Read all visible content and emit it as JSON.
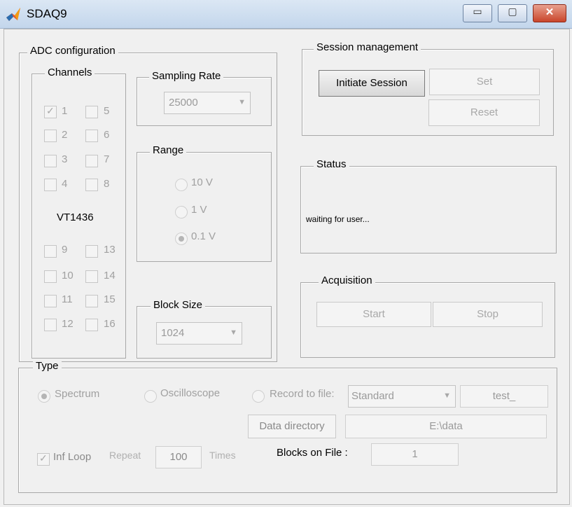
{
  "window": {
    "title": "SDAQ9",
    "minimize": "▭",
    "maximize": "▢",
    "close": "✕"
  },
  "adc": {
    "legend": "ADC configuration",
    "channels": {
      "legend": "Channels",
      "top": [
        "1",
        "2",
        "3",
        "4",
        "5",
        "6",
        "7",
        "8"
      ],
      "board_label": "VT1436",
      "bottom": [
        "9",
        "10",
        "11",
        "12",
        "13",
        "14",
        "15",
        "16"
      ],
      "checked": [
        "1"
      ]
    },
    "sampling_rate": {
      "legend": "Sampling Rate",
      "value": "25000"
    },
    "range": {
      "legend": "Range",
      "options": [
        "10 V",
        "1 V",
        "0.1 V"
      ],
      "selected": "0.1 V"
    },
    "block_size": {
      "legend": "Block Size",
      "value": "1024"
    }
  },
  "session": {
    "legend": "Session management",
    "initiate": "Initiate Session",
    "set": "Set",
    "reset": "Reset"
  },
  "status": {
    "legend": "Status",
    "text": "waiting for user..."
  },
  "acquisition": {
    "legend": "Acquisition",
    "start": "Start",
    "stop": "Stop"
  },
  "type": {
    "legend": "Type",
    "spectrum": "Spectrum",
    "oscilloscope": "Oscilloscope",
    "record": "Record to file:",
    "record_format": "Standard",
    "file_prefix": "test_",
    "data_dir_button": "Data directory",
    "data_dir": "E:\\data",
    "inf_loop": "Inf Loop",
    "repeat": "Repeat",
    "repeat_value": "100",
    "times": "Times",
    "blocks_on_file_label": "Blocks on File :",
    "blocks_on_file": "1"
  }
}
